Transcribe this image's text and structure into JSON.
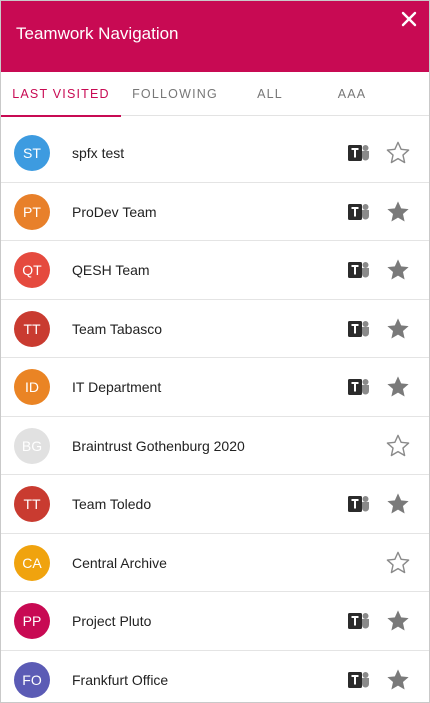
{
  "header": {
    "title": "Teamwork Navigation",
    "color": "#c80a53"
  },
  "tabs": [
    {
      "label": "LAST VISITED",
      "active": true
    },
    {
      "label": "FOLLOWING",
      "active": false
    },
    {
      "label": "ALL",
      "active": false
    },
    {
      "label": "AAA",
      "active": false
    }
  ],
  "items": [
    {
      "initials": "ST",
      "name": "spfx test",
      "color": "#3d9be0",
      "teams": true,
      "starred": false
    },
    {
      "initials": "PT",
      "name": "ProDev Team",
      "color": "#e8802a",
      "teams": true,
      "starred": true
    },
    {
      "initials": "QT",
      "name": "QESH Team",
      "color": "#e54a3e",
      "teams": true,
      "starred": true
    },
    {
      "initials": "TT",
      "name": "Team Tabasco",
      "color": "#c93b30",
      "teams": true,
      "starred": true
    },
    {
      "initials": "ID",
      "name": "IT Department",
      "color": "#ea8424",
      "teams": true,
      "starred": true
    },
    {
      "initials": "BG",
      "name": "Braintrust Gothenburg 2020",
      "color": "#e1e1e1",
      "teams": false,
      "starred": false
    },
    {
      "initials": "TT",
      "name": "Team Toledo",
      "color": "#c93b30",
      "teams": true,
      "starred": true
    },
    {
      "initials": "CA",
      "name": "Central Archive",
      "color": "#f0a30e",
      "teams": false,
      "starred": false
    },
    {
      "initials": "PP",
      "name": "Project Pluto",
      "color": "#c80a53",
      "teams": true,
      "starred": true
    },
    {
      "initials": "FO",
      "name": "Frankfurt Office",
      "color": "#5b5bb5",
      "teams": true,
      "starred": true
    }
  ],
  "icons": {
    "close": "close-icon",
    "teams": "teams-icon",
    "star_filled": "star-filled-icon",
    "star_outline": "star-outline-icon"
  }
}
